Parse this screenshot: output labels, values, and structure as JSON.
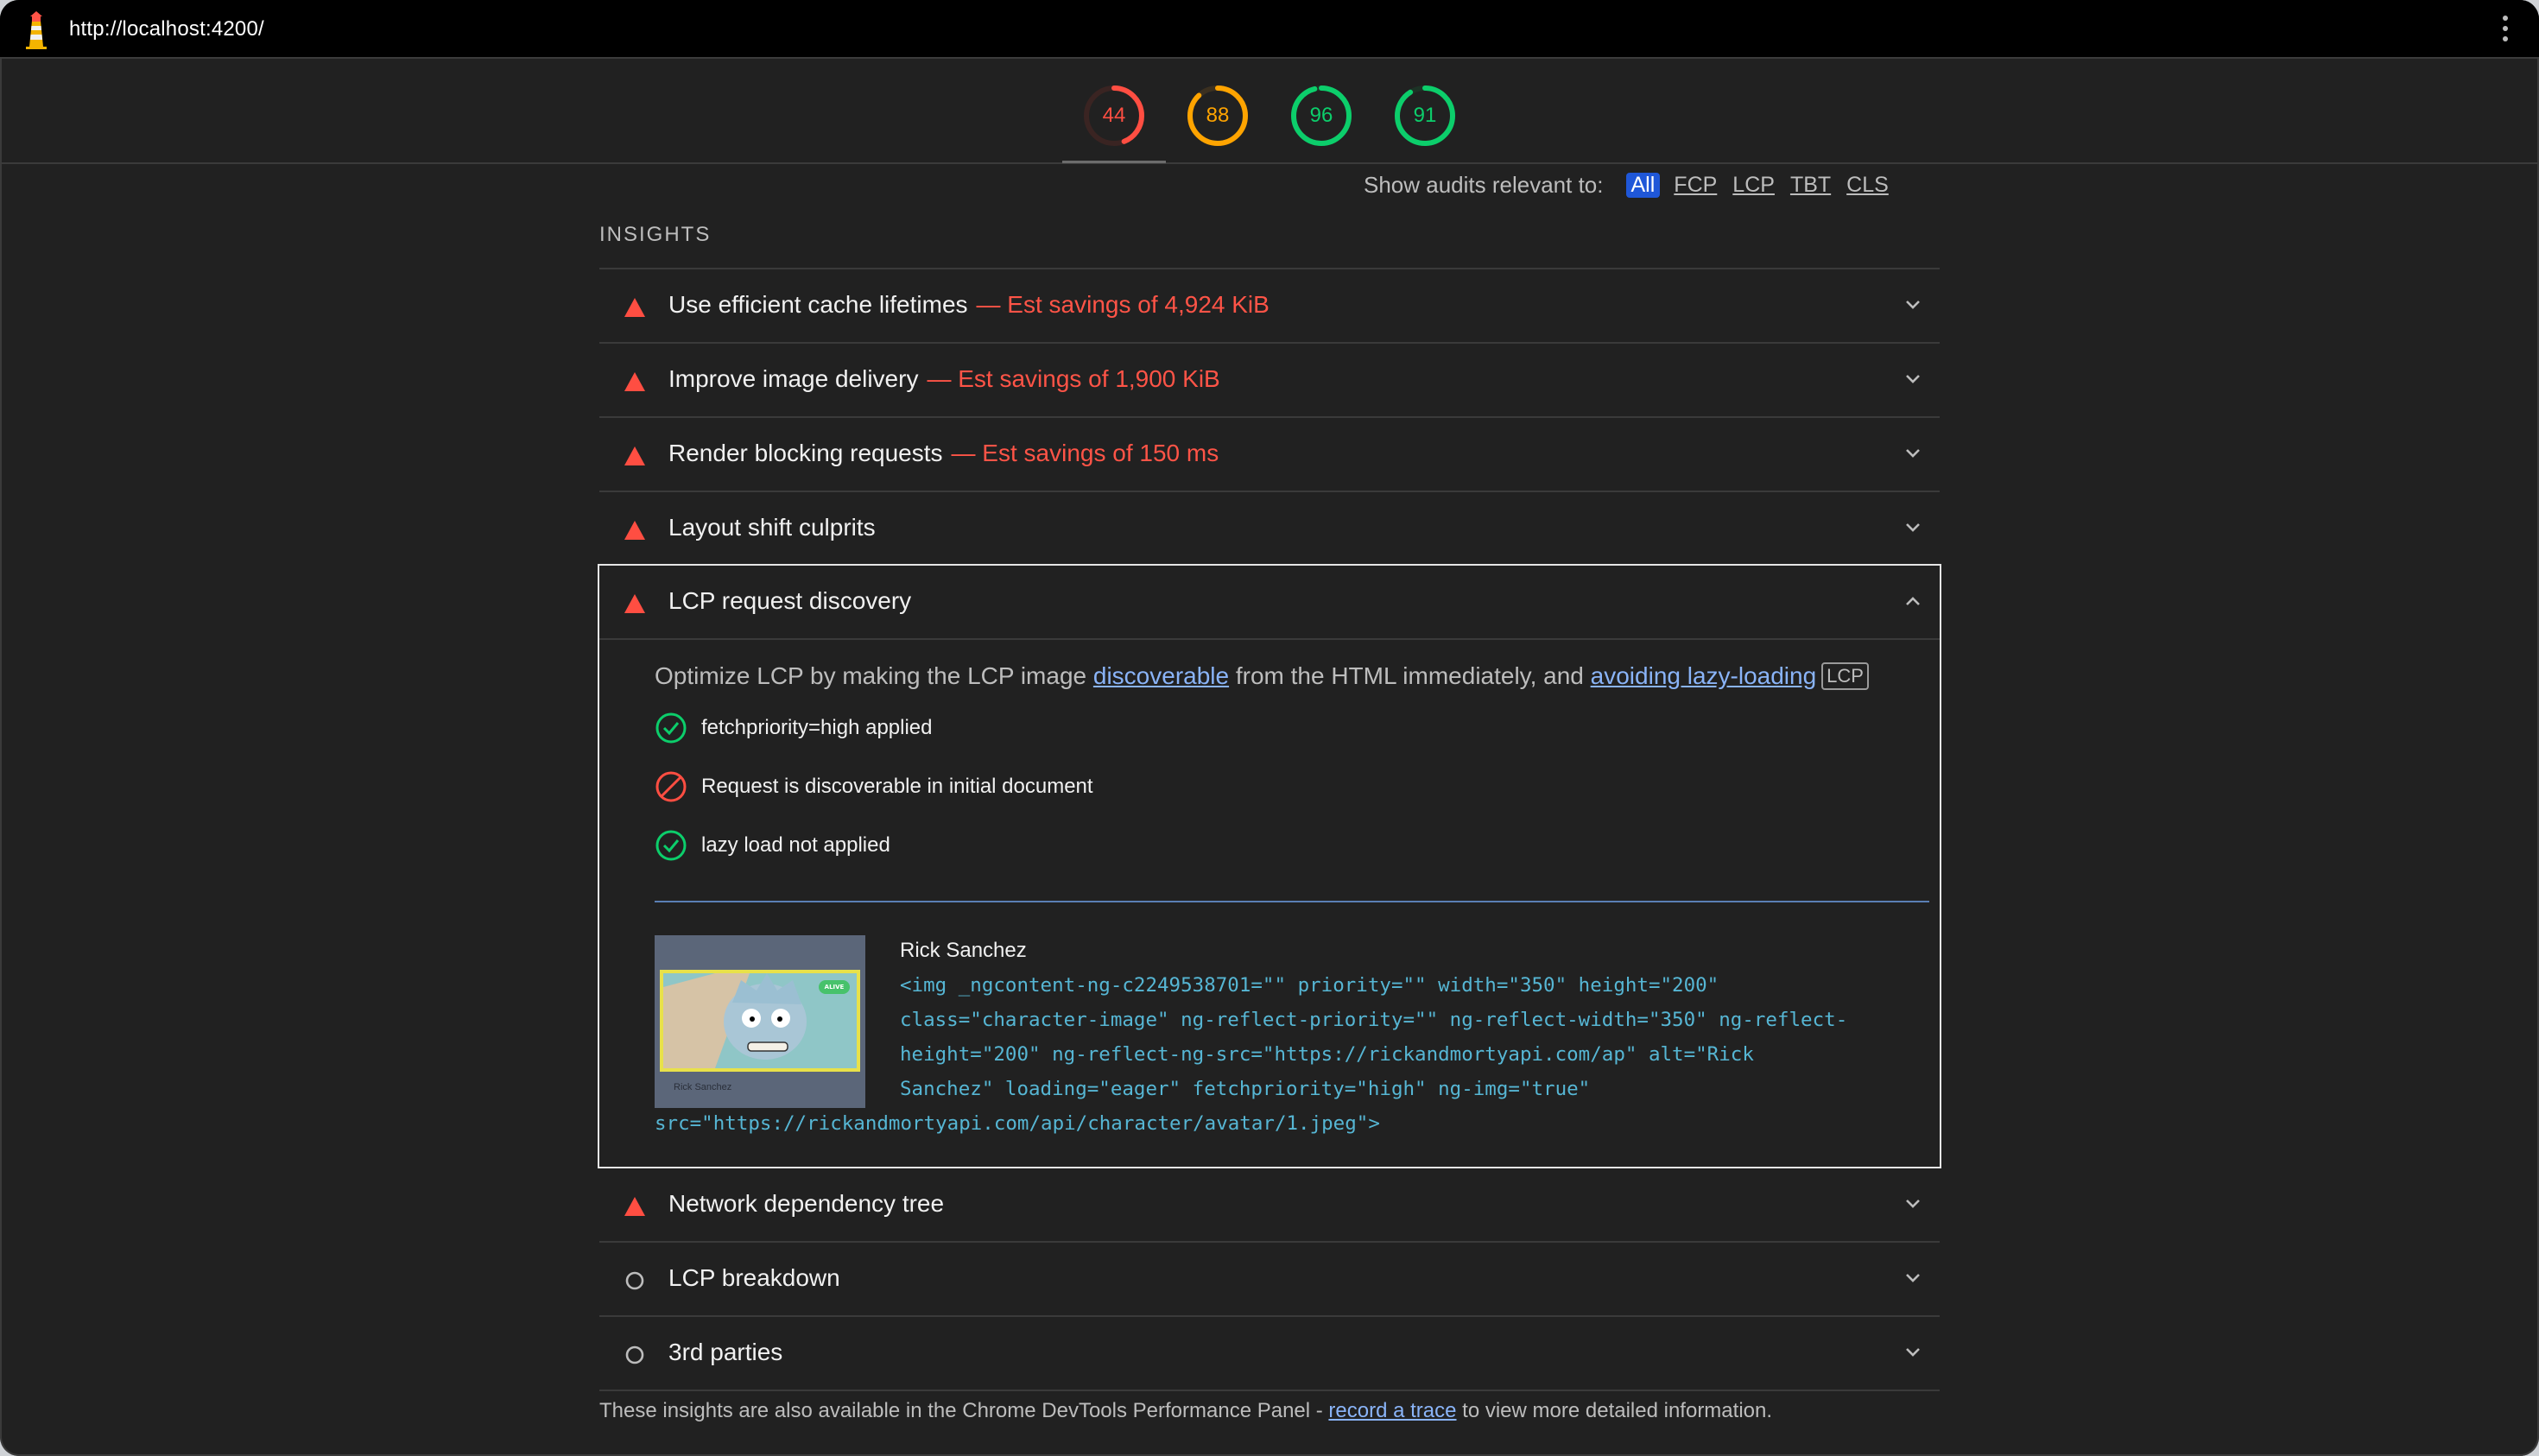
{
  "browser": {
    "url": "http://localhost:4200/",
    "menu_icon": "kebab-menu-icon"
  },
  "scores": [
    {
      "value": "44",
      "color": "#ff4e42",
      "fraction": 0.44
    },
    {
      "value": "88",
      "color": "#ffa400",
      "fraction": 0.88
    },
    {
      "value": "96",
      "color": "#0cce6b",
      "fraction": 0.96
    },
    {
      "value": "91",
      "color": "#0cce6b",
      "fraction": 0.91
    }
  ],
  "filter": {
    "label": "Show audits relevant to:",
    "chips": [
      "All",
      "FCP",
      "LCP",
      "TBT",
      "CLS"
    ],
    "active": "All"
  },
  "insights": {
    "section_title": "INSIGHTS",
    "items": [
      {
        "title": "Use efficient cache lifetimes",
        "savings": "— Est savings of 4,924 KiB",
        "status": "fail"
      },
      {
        "title": "Improve image delivery",
        "savings": "— Est savings of 1,900 KiB",
        "status": "fail"
      },
      {
        "title": "Render blocking requests",
        "savings": "— Est savings of 150 ms",
        "status": "fail"
      },
      {
        "title": "Layout shift culprits",
        "savings": "",
        "status": "fail"
      }
    ],
    "expanded": {
      "title": "LCP request discovery",
      "desc_pre": "Optimize LCP by making the LCP image ",
      "link1": "discoverable",
      "desc_mid": " from the HTML immediately, and ",
      "link2": "avoiding lazy-loading",
      "badge": "LCP",
      "checks": [
        {
          "text": "fetchpriority=high applied",
          "status": "pass"
        },
        {
          "text": "Request is discoverable in initial document",
          "status": "fail"
        },
        {
          "text": "lazy load not applied",
          "status": "pass"
        }
      ],
      "node_label": "Rick Sanchez",
      "thumb_caption": "Rick Sanchez",
      "thumb_badge": "ALIVE",
      "snippet_lines": [
        "<img _ngcontent-ng-c2249538701=\"\" priority=\"\" width=\"350\" height=\"200\"",
        "class=\"character-image\" ng-reflect-priority=\"\" ng-reflect-width=\"350\" ng-reflect-",
        "height=\"200\" ng-reflect-ng-src=\"https://rickandmortyapi.com/ap\" alt=\"Rick",
        "Sanchez\" loading=\"eager\" fetchpriority=\"high\" ng-img=\"true\"",
        "src=\"https://rickandmortyapi.com/api/character/avatar/1.jpeg\">"
      ]
    },
    "after_items": [
      {
        "title": "Network dependency tree",
        "status": "fail"
      },
      {
        "title": "LCP breakdown",
        "status": "neutral"
      },
      {
        "title": "3rd parties",
        "status": "neutral"
      }
    ]
  },
  "footer": {
    "pre": "These insights are also available in the Chrome DevTools Performance Panel - ",
    "link": "record a trace",
    "post": " to view more detailed information."
  }
}
